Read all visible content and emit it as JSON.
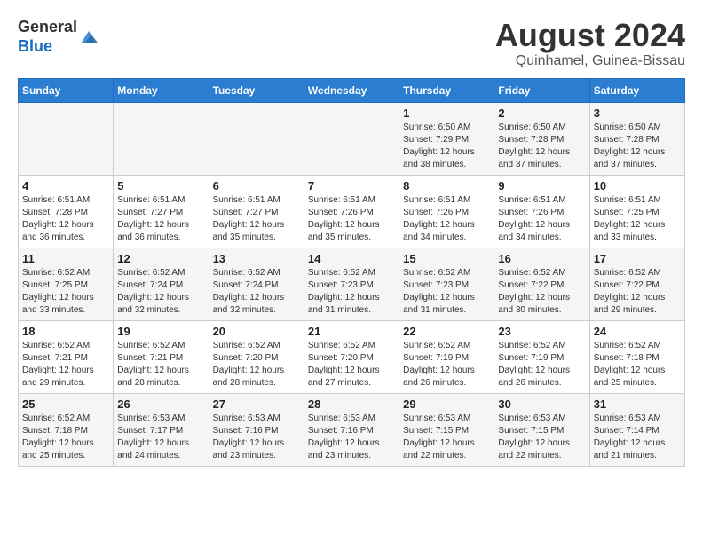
{
  "header": {
    "logo_line1": "General",
    "logo_line2": "Blue",
    "main_title": "August 2024",
    "subtitle": "Quinhamel, Guinea-Bissau"
  },
  "calendar": {
    "days_of_week": [
      "Sunday",
      "Monday",
      "Tuesday",
      "Wednesday",
      "Thursday",
      "Friday",
      "Saturday"
    ],
    "weeks": [
      {
        "days": [
          {
            "number": "",
            "info": ""
          },
          {
            "number": "",
            "info": ""
          },
          {
            "number": "",
            "info": ""
          },
          {
            "number": "",
            "info": ""
          },
          {
            "number": "1",
            "info": "Sunrise: 6:50 AM\nSunset: 7:29 PM\nDaylight: 12 hours and 38 minutes."
          },
          {
            "number": "2",
            "info": "Sunrise: 6:50 AM\nSunset: 7:28 PM\nDaylight: 12 hours and 37 minutes."
          },
          {
            "number": "3",
            "info": "Sunrise: 6:50 AM\nSunset: 7:28 PM\nDaylight: 12 hours and 37 minutes."
          }
        ]
      },
      {
        "days": [
          {
            "number": "4",
            "info": "Sunrise: 6:51 AM\nSunset: 7:28 PM\nDaylight: 12 hours and 36 minutes."
          },
          {
            "number": "5",
            "info": "Sunrise: 6:51 AM\nSunset: 7:27 PM\nDaylight: 12 hours and 36 minutes."
          },
          {
            "number": "6",
            "info": "Sunrise: 6:51 AM\nSunset: 7:27 PM\nDaylight: 12 hours and 35 minutes."
          },
          {
            "number": "7",
            "info": "Sunrise: 6:51 AM\nSunset: 7:26 PM\nDaylight: 12 hours and 35 minutes."
          },
          {
            "number": "8",
            "info": "Sunrise: 6:51 AM\nSunset: 7:26 PM\nDaylight: 12 hours and 34 minutes."
          },
          {
            "number": "9",
            "info": "Sunrise: 6:51 AM\nSunset: 7:26 PM\nDaylight: 12 hours and 34 minutes."
          },
          {
            "number": "10",
            "info": "Sunrise: 6:51 AM\nSunset: 7:25 PM\nDaylight: 12 hours and 33 minutes."
          }
        ]
      },
      {
        "days": [
          {
            "number": "11",
            "info": "Sunrise: 6:52 AM\nSunset: 7:25 PM\nDaylight: 12 hours and 33 minutes."
          },
          {
            "number": "12",
            "info": "Sunrise: 6:52 AM\nSunset: 7:24 PM\nDaylight: 12 hours and 32 minutes."
          },
          {
            "number": "13",
            "info": "Sunrise: 6:52 AM\nSunset: 7:24 PM\nDaylight: 12 hours and 32 minutes."
          },
          {
            "number": "14",
            "info": "Sunrise: 6:52 AM\nSunset: 7:23 PM\nDaylight: 12 hours and 31 minutes."
          },
          {
            "number": "15",
            "info": "Sunrise: 6:52 AM\nSunset: 7:23 PM\nDaylight: 12 hours and 31 minutes."
          },
          {
            "number": "16",
            "info": "Sunrise: 6:52 AM\nSunset: 7:22 PM\nDaylight: 12 hours and 30 minutes."
          },
          {
            "number": "17",
            "info": "Sunrise: 6:52 AM\nSunset: 7:22 PM\nDaylight: 12 hours and 29 minutes."
          }
        ]
      },
      {
        "days": [
          {
            "number": "18",
            "info": "Sunrise: 6:52 AM\nSunset: 7:21 PM\nDaylight: 12 hours and 29 minutes."
          },
          {
            "number": "19",
            "info": "Sunrise: 6:52 AM\nSunset: 7:21 PM\nDaylight: 12 hours and 28 minutes."
          },
          {
            "number": "20",
            "info": "Sunrise: 6:52 AM\nSunset: 7:20 PM\nDaylight: 12 hours and 28 minutes."
          },
          {
            "number": "21",
            "info": "Sunrise: 6:52 AM\nSunset: 7:20 PM\nDaylight: 12 hours and 27 minutes."
          },
          {
            "number": "22",
            "info": "Sunrise: 6:52 AM\nSunset: 7:19 PM\nDaylight: 12 hours and 26 minutes."
          },
          {
            "number": "23",
            "info": "Sunrise: 6:52 AM\nSunset: 7:19 PM\nDaylight: 12 hours and 26 minutes."
          },
          {
            "number": "24",
            "info": "Sunrise: 6:52 AM\nSunset: 7:18 PM\nDaylight: 12 hours and 25 minutes."
          }
        ]
      },
      {
        "days": [
          {
            "number": "25",
            "info": "Sunrise: 6:52 AM\nSunset: 7:18 PM\nDaylight: 12 hours and 25 minutes."
          },
          {
            "number": "26",
            "info": "Sunrise: 6:53 AM\nSunset: 7:17 PM\nDaylight: 12 hours and 24 minutes."
          },
          {
            "number": "27",
            "info": "Sunrise: 6:53 AM\nSunset: 7:16 PM\nDaylight: 12 hours and 23 minutes."
          },
          {
            "number": "28",
            "info": "Sunrise: 6:53 AM\nSunset: 7:16 PM\nDaylight: 12 hours and 23 minutes."
          },
          {
            "number": "29",
            "info": "Sunrise: 6:53 AM\nSunset: 7:15 PM\nDaylight: 12 hours and 22 minutes."
          },
          {
            "number": "30",
            "info": "Sunrise: 6:53 AM\nSunset: 7:15 PM\nDaylight: 12 hours and 22 minutes."
          },
          {
            "number": "31",
            "info": "Sunrise: 6:53 AM\nSunset: 7:14 PM\nDaylight: 12 hours and 21 minutes."
          }
        ]
      }
    ]
  }
}
